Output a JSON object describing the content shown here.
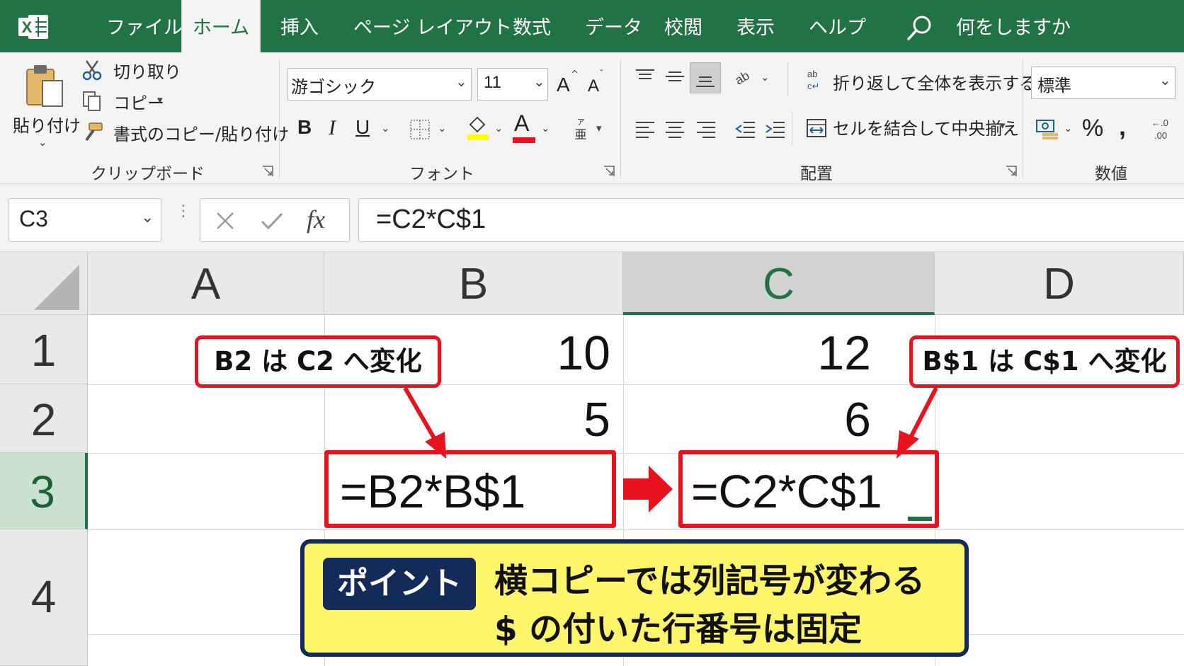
{
  "tabs": [
    "ファイル",
    "ホーム",
    "挿入",
    "ページ レイアウト",
    "数式",
    "データ",
    "校閲",
    "表示",
    "ヘルプ"
  ],
  "active_tab": "ホーム",
  "search_placeholder": "何をしますか",
  "ribbon": {
    "clipboard": {
      "paste": "貼り付け",
      "cut": "切り取り",
      "copy": "コピー",
      "format_painter": "書式のコピー/貼り付け",
      "label": "クリップボード"
    },
    "font": {
      "name": "游ゴシック",
      "size": "11",
      "bold": "B",
      "italic": "I",
      "underline": "U",
      "font_color_letter": "A",
      "grow": "A",
      "shrink": "A",
      "label": "フォント",
      "highlight_color": "#ffff00",
      "font_color": "#e8131f"
    },
    "alignment": {
      "wrap": "折り返して全体を表示する",
      "merge": "セルを結合して中央揃え",
      "label": "配置"
    },
    "number": {
      "format": "標準",
      "percent": "%",
      "comma": ",",
      "label": "数値"
    }
  },
  "formula_bar": {
    "name_box": "C3",
    "formula": "=C2*C$1"
  },
  "grid": {
    "columns": [
      "A",
      "B",
      "C",
      "D"
    ],
    "selected_column": "C",
    "rows": [
      "1",
      "2",
      "3",
      "4"
    ],
    "selected_row": "3",
    "cells": {
      "B1": "10",
      "C1": "12",
      "B2": "5",
      "C2": "6",
      "B3": "=B2*B$1",
      "C3": "=C2*C$1"
    }
  },
  "annotations": {
    "callout_left": "B2 は C2 へ変化",
    "callout_right": "B$1 は C$1 へ変化",
    "point_label": "ポイント",
    "point_line1": "横コピーでは列記号が変わる",
    "point_line2": "$ の付いた行番号は固定"
  },
  "colors": {
    "excel_green": "#217346",
    "annotation_red": "#e8131f",
    "point_navy": "#142a58",
    "point_yellow": "#fdf56a"
  }
}
